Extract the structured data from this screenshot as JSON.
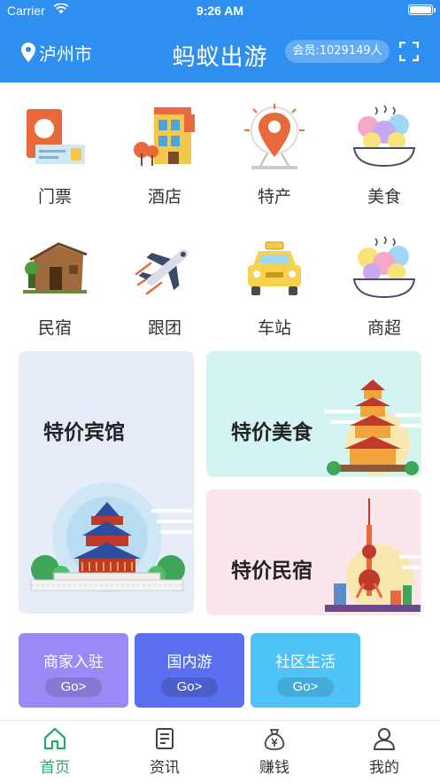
{
  "status_bar": {
    "carrier": "Carrier",
    "time": "9:26 AM"
  },
  "header": {
    "location": "泸州市",
    "title": "蚂蚁出游",
    "member_count": "会员:1029149人"
  },
  "categories": [
    {
      "label": "门票",
      "icon": "ticket-icon"
    },
    {
      "label": "酒店",
      "icon": "hotel-icon"
    },
    {
      "label": "特产",
      "icon": "specialty-pin-icon"
    },
    {
      "label": "美食",
      "icon": "food-bowl-icon"
    },
    {
      "label": "民宿",
      "icon": "homestay-hut-icon"
    },
    {
      "label": "跟团",
      "icon": "airplane-icon"
    },
    {
      "label": "车站",
      "icon": "taxi-icon"
    },
    {
      "label": "商超",
      "icon": "market-bowl-icon"
    }
  ],
  "promos": {
    "hotel": "特价宾馆",
    "food": "特价美食",
    "homestay": "特价民宿"
  },
  "services": [
    {
      "label": "商家入驻",
      "go": "Go>",
      "color": "#9b8af5"
    },
    {
      "label": "国内游",
      "go": "Go>",
      "color": "#5a6ff0"
    },
    {
      "label": "社区生活",
      "go": "Go>",
      "color": "#4fc3f7"
    }
  ],
  "tabs": [
    {
      "label": "首页",
      "icon": "home-icon",
      "active": true
    },
    {
      "label": "资讯",
      "icon": "news-icon",
      "active": false
    },
    {
      "label": "赚钱",
      "icon": "money-bag-icon",
      "active": false
    },
    {
      "label": "我的",
      "icon": "profile-icon",
      "active": false
    }
  ],
  "colors": {
    "header": "#2f8ff0",
    "active_tab": "#2aa868"
  }
}
